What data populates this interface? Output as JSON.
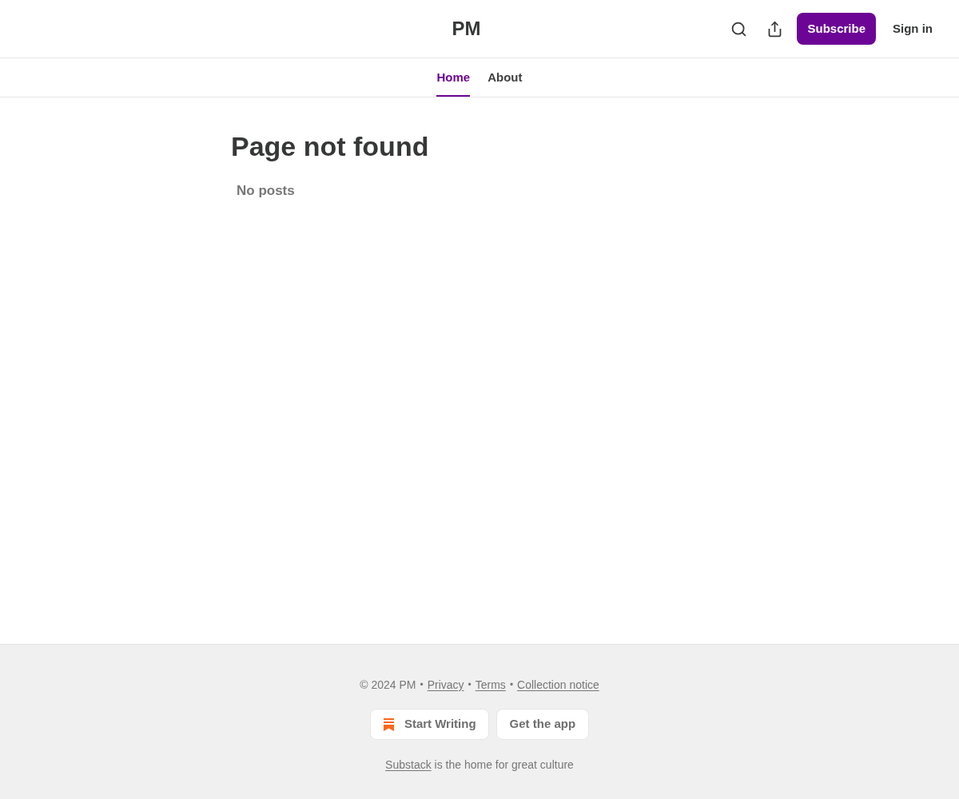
{
  "header": {
    "title": "PM",
    "subscribe": "Subscribe",
    "sign_in": "Sign in"
  },
  "nav": {
    "tabs": [
      {
        "label": "Home",
        "selected": true
      },
      {
        "label": "About",
        "selected": false
      }
    ]
  },
  "page": {
    "heading": "Page not found",
    "empty_message": "No posts"
  },
  "footer": {
    "legal": [
      {
        "kind": "text",
        "label": "© 2024 PM"
      },
      {
        "kind": "separator",
        "label": "•"
      },
      {
        "kind": "link",
        "label": "Privacy"
      },
      {
        "kind": "separator",
        "label": "•"
      },
      {
        "kind": "link",
        "label": "Terms"
      },
      {
        "kind": "separator",
        "label": "•"
      },
      {
        "kind": "link",
        "label": "Collection notice"
      }
    ],
    "buttons": [
      {
        "kind": "logo",
        "label": "Start Writing"
      },
      {
        "kind": "plain",
        "label": "Get the app"
      }
    ],
    "tagline": {
      "link": "Substack",
      "rest": "is the home for great culture"
    }
  }
}
